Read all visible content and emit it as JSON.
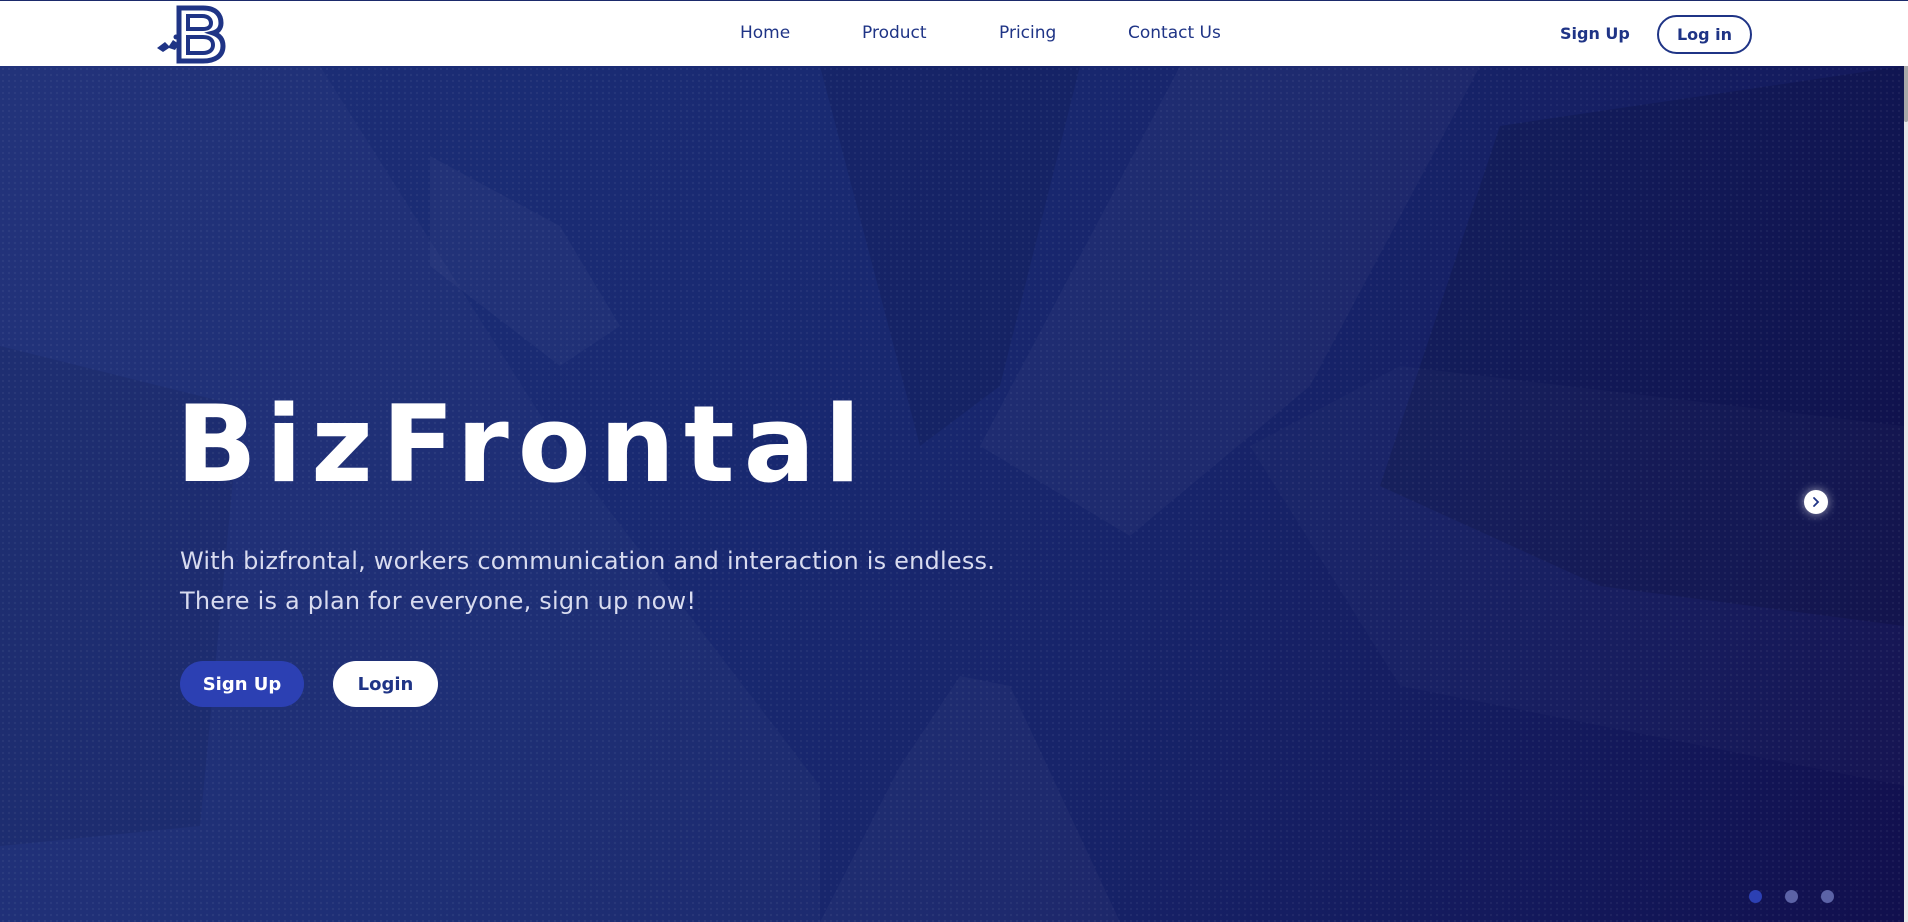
{
  "header": {
    "nav": [
      {
        "label": "Home"
      },
      {
        "label": "Product"
      },
      {
        "label": "Pricing"
      },
      {
        "label": "Contact Us"
      }
    ],
    "signup_label": "Sign Up",
    "login_label": "Log in"
  },
  "hero": {
    "title": "BizFrontal",
    "line1": "With bizfrontal, workers communication and interaction is endless.",
    "line2": "There is a plan for everyone, sign up now!",
    "signup_label": "Sign Up",
    "login_label": "Login",
    "carousel": {
      "slides": 3,
      "active_index": 0
    }
  },
  "colors": {
    "brand": "#1f3486",
    "hero_bg": "#192a72",
    "primary_button": "#2c40b3",
    "dot_active": "#2c40b3",
    "dot_inactive": "#5c63a6"
  },
  "icons": {
    "logo": "bizfrontal-b-logo",
    "next": "chevron-right-icon"
  }
}
